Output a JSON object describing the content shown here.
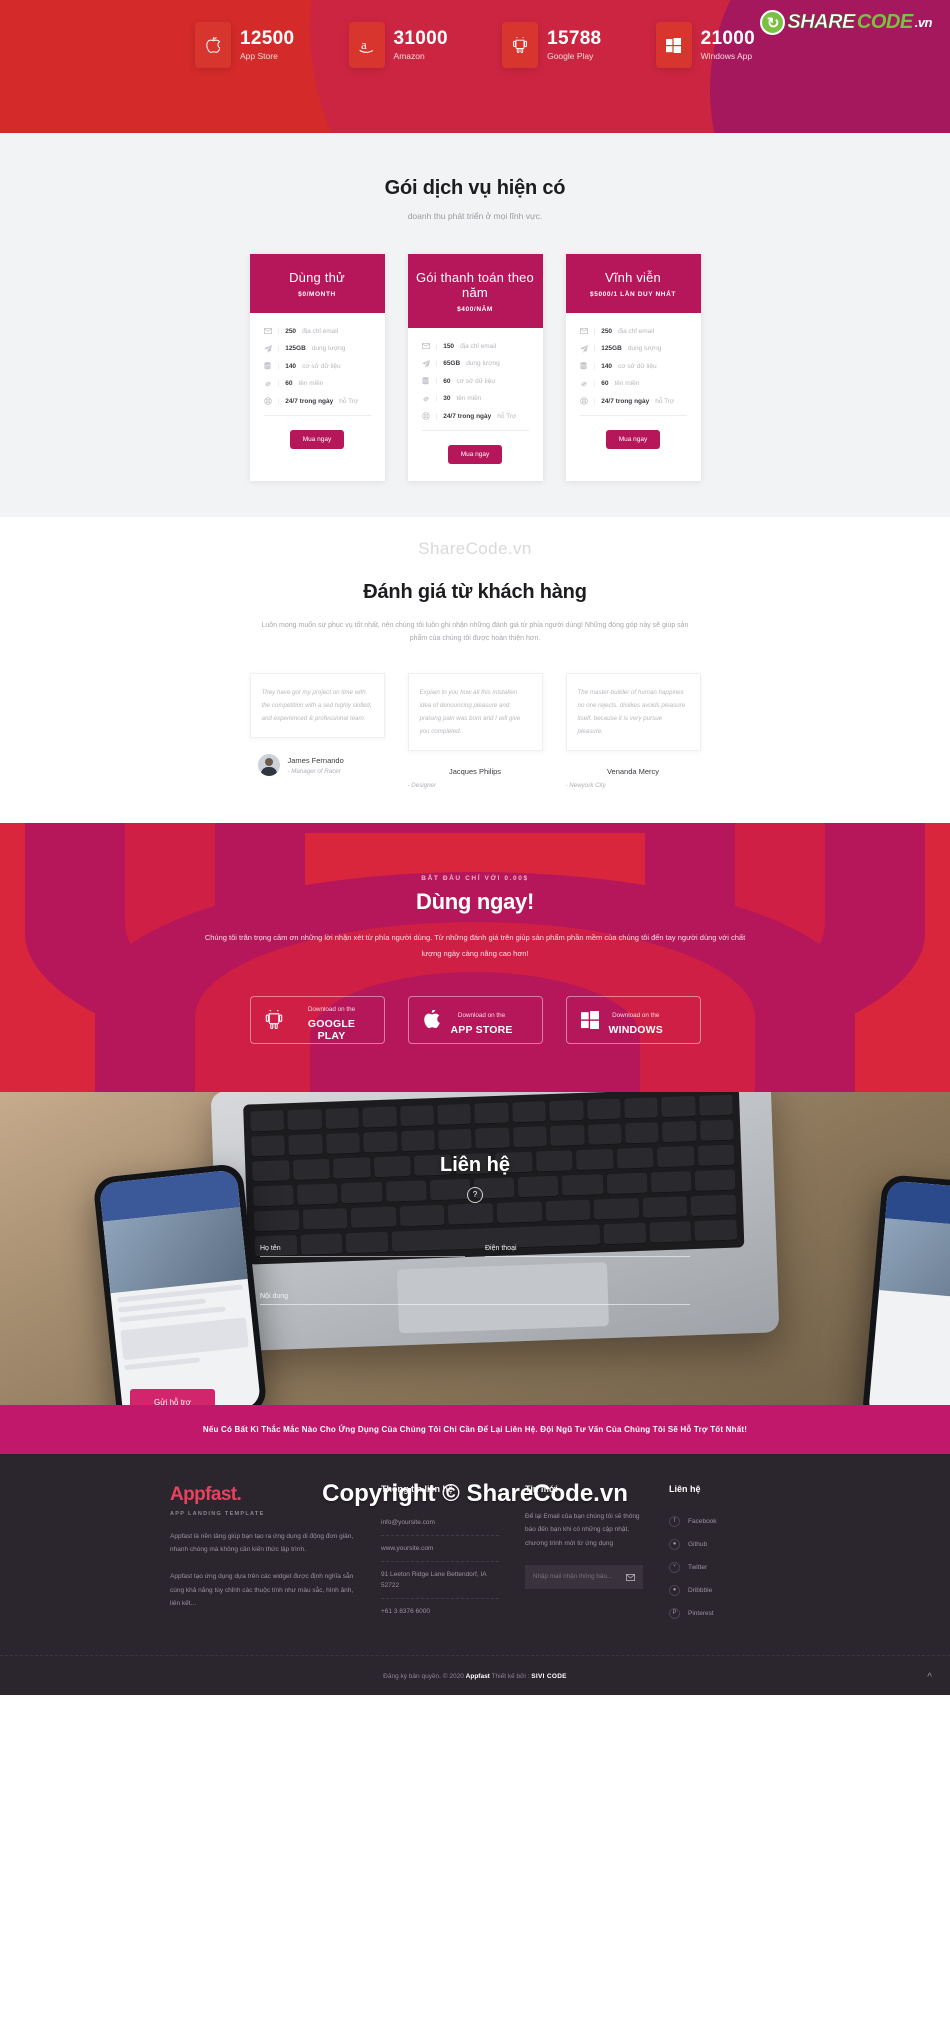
{
  "stats": {
    "items": [
      {
        "icon": "apple-icon",
        "number": "12500",
        "label": "App Store"
      },
      {
        "icon": "amazon-icon",
        "number": "31000",
        "label": "Amazon"
      },
      {
        "icon": "android-icon",
        "number": "15788",
        "label": "Google Play"
      },
      {
        "icon": "windows-icon",
        "number": "21000",
        "label": "Windows App"
      }
    ]
  },
  "brandmark": {
    "share": "SHARE",
    "code": "CODE",
    "vn": ".vn",
    "glyph": "↻"
  },
  "pricing": {
    "title": "Gói dịch vụ hiện có",
    "subtitle": "doanh thu phát triển ở mọi lĩnh vực.",
    "cards": [
      {
        "name": "Dùng thử",
        "price": "$0/MONTH",
        "features": [
          {
            "icon": "envelope-icon",
            "value": "250",
            "text": "địa chỉ email"
          },
          {
            "icon": "paper-plane-icon",
            "value": "125GB",
            "text": "dung lượng"
          },
          {
            "icon": "database-icon",
            "value": "140",
            "text": "cơ sở dữ liệu"
          },
          {
            "icon": "link-icon",
            "value": "60",
            "text": "tên miền"
          },
          {
            "icon": "support-icon",
            "value": "24/7 trong ngày",
            "text": "hỗ Trợ"
          }
        ],
        "button": "Mua ngay"
      },
      {
        "name": "Gói thanh toán theo năm",
        "price": "$400/NĂM",
        "features": [
          {
            "icon": "envelope-icon",
            "value": "150",
            "text": "địa chỉ email"
          },
          {
            "icon": "paper-plane-icon",
            "value": "65GB",
            "text": "dung lượng"
          },
          {
            "icon": "database-icon",
            "value": "60",
            "text": "cơ sở dữ liệu"
          },
          {
            "icon": "link-icon",
            "value": "30",
            "text": "tên miền"
          },
          {
            "icon": "support-icon",
            "value": "24/7 trong ngày",
            "text": "hỗ Trợ"
          }
        ],
        "button": "Mua ngay"
      },
      {
        "name": "Vĩnh viễn",
        "price": "$5000/1 LẦN DUY NHẤT",
        "features": [
          {
            "icon": "envelope-icon",
            "value": "250",
            "text": "địa chỉ email"
          },
          {
            "icon": "paper-plane-icon",
            "value": "125GB",
            "text": "dung lượng"
          },
          {
            "icon": "database-icon",
            "value": "140",
            "text": "cơ sở dữ liệu"
          },
          {
            "icon": "link-icon",
            "value": "60",
            "text": "tên miền"
          },
          {
            "icon": "support-icon",
            "value": "24/7 trong ngày",
            "text": "hỗ Trợ"
          }
        ],
        "button": "Mua ngay"
      }
    ]
  },
  "watermark_top": "ShareCode.vn",
  "watermark_center": "Copyright © ShareCode.vn",
  "testimonials": {
    "title": "Đánh giá từ khách hàng",
    "description": "Luôn mong muốn sự phục vụ tốt nhất, nên chúng tôi luôn ghi nhận những đánh giá từ phía người dùng! Những đóng góp này sẽ giúp sản phẩm của chúng tôi được hoàn thiện hơn.",
    "items": [
      {
        "quote": "They have got my project on time with the competition with a sed highly skilled, and experienced & professional team.",
        "name": "James Fernando",
        "role": "- Manager of Racer"
      },
      {
        "quote": "Explain to you how all this mistaken idea of denouncing pleasure and praising pain was born and I will give you completed.",
        "name": "Jacques Philips",
        "role": "- Designer"
      },
      {
        "quote": "The master-builder of human happines no one rejects. dislikes avoids pleasure itself. because it is very pursue pleasure.",
        "name": "Venanda Mercy",
        "role": "- Newyork City"
      }
    ]
  },
  "cta": {
    "kicker": "BẮT ĐẦU CHỈ VỚI 0.00$",
    "title": "Dùng ngay!",
    "description": "Chúng tôi trân trọng cảm ơn những lời nhận xét từ phía người dùng. Từ những đánh giá trên giúp sản phẩm phần mềm của chúng tôi đến tay người dùng với chất lượng ngày càng nâng cao hơn!",
    "buttons": [
      {
        "icon": "android-icon",
        "small": "Download on the",
        "big": "GOOGLE PLAY"
      },
      {
        "icon": "apple-icon",
        "small": "Download on the",
        "big": "APP STORE"
      },
      {
        "icon": "windows-icon",
        "small": "Download on the",
        "big": "WINDOWS"
      }
    ]
  },
  "contact": {
    "title": "Liên hệ",
    "help_icon": "question-icon",
    "fields": [
      {
        "name": "ho-ten",
        "label": "Họ tên"
      },
      {
        "name": "dien-thoai",
        "label": "Điện thoại"
      },
      {
        "name": "noi-dung",
        "label": "Nội dung"
      }
    ],
    "submit": "Gửi hỗ trợ"
  },
  "strip": {
    "text": "Nếu Có Bất Kì Thắc Mắc Nào Cho Ứng Dụng Của Chúng Tôi Chỉ Cần Để Lại Liên Hệ. Đội Ngũ Tư Vấn Của Chúng Tôi Sẽ Hỗ Trợ Tốt Nhất!"
  },
  "footer": {
    "logo_app": "App",
    "logo_fast": "fast",
    "logo_dot": ".",
    "logo_sub": "APP LANDING TEMPLATE",
    "about_p1": "Appfast là nền tảng giúp bạn tạo ra ứng dụng di động đơn giản, nhanh chóng mà không cần kiến thức lập trình.",
    "about_p2": "Appfast tạo ứng dụng dựa trên các widget được định nghĩa sẵn cùng khả năng tùy chỉnh các thuộc tính như màu sắc, hình ảnh, liên kết...",
    "contact_head": "Thông tin liên hệ",
    "contact_items": [
      "info@yoursite.com",
      "www.yoursite.com",
      "91 Leeton Ridge Lane Bettendorf, IA 52722",
      "+61 3 8376 6000"
    ],
    "news_head": "Tin mới",
    "news_text": "Để lại Email của bạn chúng tôi sẽ thông báo đến bạn khi có những cập nhật, chương trình mới từ ứng dụng",
    "news_placeholder": "Nhập mail nhận thông báo...",
    "news_icon": "envelope-icon",
    "social_head": "Liên hệ",
    "socials": [
      {
        "icon": "facebook-icon",
        "label": "Facebook",
        "glyph": "f"
      },
      {
        "icon": "github-icon",
        "label": "Github",
        "glyph": "●"
      },
      {
        "icon": "twitter-icon",
        "label": "Twitter",
        "glyph": "ᵛ"
      },
      {
        "icon": "dribbble-icon",
        "label": "Dribbble",
        "glyph": "●"
      },
      {
        "icon": "pinterest-icon",
        "label": "Pinterest",
        "glyph": "P"
      }
    ],
    "bottom_pre": "Đăng ký bản quyền. © 2020",
    "bottom_brand": "Appfast",
    "bottom_mid": "Thiết kế bởi :",
    "bottom_by": "SIVI CODE"
  }
}
